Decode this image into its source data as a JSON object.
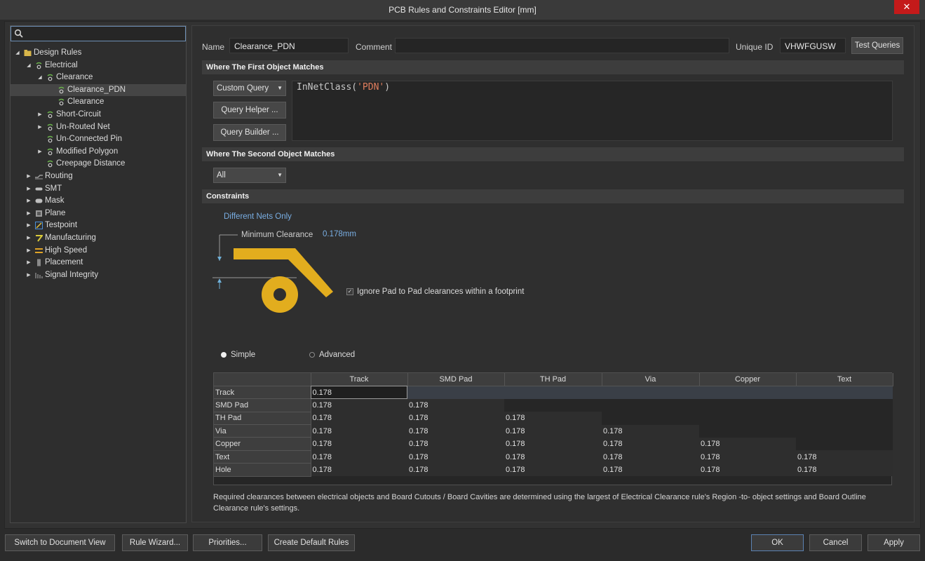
{
  "window": {
    "title": "PCB Rules and Constraints Editor [mm]",
    "close_glyph": "✕"
  },
  "search": {
    "placeholder": "",
    "icon": "search-icon"
  },
  "tree": [
    {
      "label": "Design Rules",
      "depth": 0,
      "expanded": true,
      "icon": "folder-icon",
      "color": "#d8b64a"
    },
    {
      "label": "Electrical",
      "depth": 1,
      "expanded": true,
      "icon": "rule-icon",
      "color": "#6ab04c"
    },
    {
      "label": "Clearance",
      "depth": 2,
      "expanded": true,
      "icon": "rule-icon",
      "color": "#6ab04c"
    },
    {
      "label": "Clearance_PDN",
      "depth": 3,
      "selected": true,
      "icon": "rule-icon",
      "color": "#6ab04c"
    },
    {
      "label": "Clearance",
      "depth": 3,
      "icon": "rule-icon",
      "color": "#6ab04c"
    },
    {
      "label": "Short-Circuit",
      "depth": 2,
      "expanded": false,
      "icon": "rule-icon",
      "color": "#6ab04c"
    },
    {
      "label": "Un-Routed Net",
      "depth": 2,
      "expanded": false,
      "icon": "rule-icon",
      "color": "#6ab04c"
    },
    {
      "label": "Un-Connected Pin",
      "depth": 2,
      "icon": "rule-icon",
      "color": "#6ab04c"
    },
    {
      "label": "Modified Polygon",
      "depth": 2,
      "expanded": false,
      "icon": "rule-icon",
      "color": "#6ab04c"
    },
    {
      "label": "Creepage Distance",
      "depth": 2,
      "icon": "rule-icon",
      "color": "#6ab04c"
    },
    {
      "label": "Routing",
      "depth": 1,
      "expanded": false,
      "icon": "routing-icon",
      "color": "#9a9a9a"
    },
    {
      "label": "SMT",
      "depth": 1,
      "expanded": false,
      "icon": "smt-icon",
      "color": "#bfbfbf"
    },
    {
      "label": "Mask",
      "depth": 1,
      "expanded": false,
      "icon": "mask-icon",
      "color": "#bfbfbf"
    },
    {
      "label": "Plane",
      "depth": 1,
      "expanded": false,
      "icon": "plane-icon",
      "color": "#9a9a9a"
    },
    {
      "label": "Testpoint",
      "depth": 1,
      "expanded": false,
      "icon": "testpoint-icon",
      "color": "#4b8fd6"
    },
    {
      "label": "Manufacturing",
      "depth": 1,
      "expanded": false,
      "icon": "manufacturing-icon",
      "color": "#d8c93a"
    },
    {
      "label": "High Speed",
      "depth": 1,
      "expanded": false,
      "icon": "high-speed-icon",
      "color": "#e0a426"
    },
    {
      "label": "Placement",
      "depth": 1,
      "expanded": false,
      "icon": "placement-icon",
      "color": "#8a8a8a"
    },
    {
      "label": "Signal Integrity",
      "depth": 1,
      "expanded": false,
      "icon": "signal-integrity-icon",
      "color": "#8a8a8a"
    }
  ],
  "header": {
    "name_label": "Name",
    "name_value": "Clearance_PDN",
    "comment_label": "Comment",
    "comment_value": "",
    "uid_label": "Unique ID",
    "uid_value": "VHWFGUSW",
    "test_queries": "Test Queries"
  },
  "first": {
    "title": "Where The First Object Matches",
    "mode": "Custom Query",
    "helper": "Query Helper ...",
    "builder": "Query Builder ...",
    "query_fn": "InNetClass(",
    "query_arg": "'PDN'",
    "query_close": ")"
  },
  "second": {
    "title": "Where The Second Object Matches",
    "mode": "All"
  },
  "constraints": {
    "title": "Constraints",
    "scope": "Different Nets Only",
    "min_label": "Minimum Clearance",
    "min_value": "0.178mm",
    "ignore_label": "Ignore Pad to Pad clearances within a footprint",
    "ignore_checked": true,
    "simple": "Simple",
    "advanced": "Advanced",
    "selected_mode": "Simple",
    "columns": [
      "",
      "Track",
      "SMD Pad",
      "TH Pad",
      "Via",
      "Copper",
      "Text"
    ],
    "rows": [
      {
        "name": "Track",
        "cells": [
          "0.178",
          "",
          "",
          "",
          "",
          ""
        ]
      },
      {
        "name": "SMD Pad",
        "cells": [
          "0.178",
          "0.178",
          "",
          "",
          "",
          ""
        ]
      },
      {
        "name": "TH Pad",
        "cells": [
          "0.178",
          "0.178",
          "0.178",
          "",
          "",
          ""
        ]
      },
      {
        "name": "Via",
        "cells": [
          "0.178",
          "0.178",
          "0.178",
          "0.178",
          "",
          ""
        ]
      },
      {
        "name": "Copper",
        "cells": [
          "0.178",
          "0.178",
          "0.178",
          "0.178",
          "0.178",
          ""
        ]
      },
      {
        "name": "Text",
        "cells": [
          "0.178",
          "0.178",
          "0.178",
          "0.178",
          "0.178",
          "0.178"
        ]
      },
      {
        "name": "Hole",
        "cells": [
          "0.178",
          "0.178",
          "0.178",
          "0.178",
          "0.178",
          "0.178"
        ]
      }
    ],
    "note": "Required clearances between electrical objects and Board Cutouts / Board Cavities are determined using the largest of Electrical Clearance rule's Region -to- object settings and Board Outline Clearance rule's settings."
  },
  "footer": {
    "switch": "Switch to Document View",
    "wizard": "Rule Wizard...",
    "priorities": "Priorities...",
    "defaults": "Create Default Rules",
    "ok": "OK",
    "cancel": "Cancel",
    "apply": "Apply"
  },
  "colors": {
    "accent": "#79aee3",
    "pad": "#e2ad1e",
    "ok_border": "#5b82b2",
    "close": "#c41a1a"
  }
}
